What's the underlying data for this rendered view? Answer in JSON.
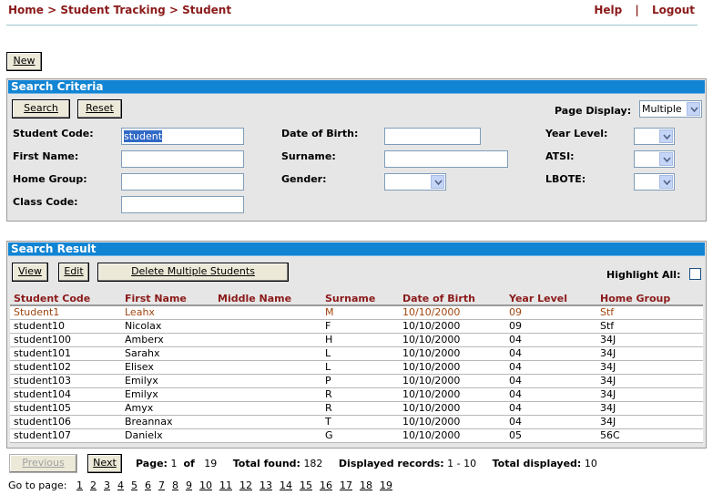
{
  "breadcrumb": {
    "home": "Home",
    "sep": ">",
    "tracking": "Student Tracking",
    "student": "Student"
  },
  "toplinks": {
    "help": "Help",
    "sep": "|",
    "logout": "Logout"
  },
  "new_button": "New",
  "search": {
    "title": "Search Criteria",
    "search_button": "Search",
    "reset_button": "Reset",
    "page_display_label": "Page Display:",
    "page_display_value": "Multiple",
    "student_code_label": "Student Code:",
    "student_code_value": "student",
    "first_name_label": "First Name:",
    "home_group_label": "Home Group:",
    "class_code_label": "Class Code:",
    "dob_label": "Date of Birth:",
    "surname_label": "Surname:",
    "gender_label": "Gender:",
    "year_level_label": "Year Level:",
    "atsi_label": "ATSI:",
    "lbote_label": "LBOTE:"
  },
  "results": {
    "title": "Search Result",
    "view_button": "View",
    "edit_button": "Edit",
    "delete_button": "Delete Multiple Students",
    "highlight_all_label": "Highlight All:",
    "columns": [
      "Student Code",
      "First Name",
      "Middle Name",
      "Surname",
      "Date of Birth",
      "Year Level",
      "Home Group"
    ],
    "rows": [
      [
        "Student1",
        "Leahx",
        "",
        "M",
        "10/10/2000",
        "09",
        "Stf"
      ],
      [
        "student10",
        "Nicolax",
        "",
        "F",
        "10/10/2000",
        "09",
        "Stf"
      ],
      [
        "student100",
        "Amberx",
        "",
        "H",
        "10/10/2000",
        "04",
        "34J"
      ],
      [
        "student101",
        "Sarahx",
        "",
        "L",
        "10/10/2000",
        "04",
        "34J"
      ],
      [
        "student102",
        "Elisex",
        "",
        "L",
        "10/10/2000",
        "04",
        "34J"
      ],
      [
        "student103",
        "Emilyx",
        "",
        "P",
        "10/10/2000",
        "04",
        "34J"
      ],
      [
        "student104",
        "Emilyx",
        "",
        "R",
        "10/10/2000",
        "04",
        "34J"
      ],
      [
        "student105",
        "Amyx",
        "",
        "R",
        "10/10/2000",
        "04",
        "34J"
      ],
      [
        "student106",
        "Breannax",
        "",
        "T",
        "10/10/2000",
        "04",
        "34J"
      ],
      [
        "student107",
        "Danielx",
        "",
        "G",
        "10/10/2000",
        "05",
        "56C"
      ]
    ]
  },
  "pager": {
    "previous": "Previous",
    "next": "Next",
    "page_label": "Page:",
    "page_current": "1",
    "of_label": "of",
    "page_total": "19",
    "total_found_label": "Total found:",
    "total_found": "182",
    "displayed_records_label": "Displayed records:",
    "displayed_records": "1 - 10",
    "total_displayed_label": "Total displayed:",
    "total_displayed": "10",
    "goto_label": "Go to page:",
    "pages": [
      "1",
      "2",
      "3",
      "4",
      "5",
      "6",
      "7",
      "8",
      "9",
      "10",
      "11",
      "12",
      "13",
      "14",
      "15",
      "16",
      "17",
      "18",
      "19"
    ]
  }
}
